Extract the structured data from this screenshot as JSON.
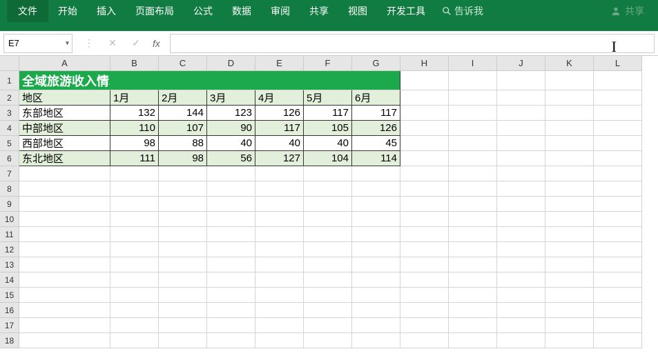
{
  "ribbon": {
    "tabs": [
      "文件",
      "开始",
      "插入",
      "页面布局",
      "公式",
      "数据",
      "审阅",
      "共享",
      "视图",
      "开发工具"
    ],
    "tell_me": "告诉我",
    "share": "共享"
  },
  "formula_bar": {
    "name_box": "E7",
    "fx_label": "fx",
    "formula": ""
  },
  "grid": {
    "columns": [
      "A",
      "B",
      "C",
      "D",
      "E",
      "F",
      "G",
      "H",
      "I",
      "J",
      "K",
      "L"
    ],
    "row_numbers": [
      1,
      2,
      3,
      4,
      5,
      6,
      7,
      8,
      9,
      10,
      11,
      12,
      13,
      14,
      15,
      16,
      17,
      18
    ],
    "title": "全域旅游收入情况（千万元）",
    "headers": [
      "地区",
      "1月",
      "2月",
      "3月",
      "4月",
      "5月",
      "6月"
    ],
    "data": [
      {
        "region": "东部地区",
        "values": [
          132,
          144,
          123,
          126,
          117,
          117
        ]
      },
      {
        "region": "中部地区",
        "values": [
          110,
          107,
          90,
          117,
          105,
          126
        ]
      },
      {
        "region": "西部地区",
        "values": [
          98,
          88,
          40,
          40,
          40,
          45
        ]
      },
      {
        "region": "东北地区",
        "values": [
          111,
          98,
          56,
          127,
          104,
          114
        ]
      }
    ]
  },
  "chart_data": {
    "type": "table",
    "title": "全域旅游收入情况（千万元）",
    "categories": [
      "1月",
      "2月",
      "3月",
      "4月",
      "5月",
      "6月"
    ],
    "series": [
      {
        "name": "东部地区",
        "values": [
          132,
          144,
          123,
          126,
          117,
          117
        ]
      },
      {
        "name": "中部地区",
        "values": [
          110,
          107,
          90,
          117,
          105,
          126
        ]
      },
      {
        "name": "西部地区",
        "values": [
          98,
          88,
          40,
          40,
          40,
          45
        ]
      },
      {
        "name": "东北地区",
        "values": [
          111,
          98,
          56,
          127,
          104,
          114
        ]
      }
    ]
  }
}
